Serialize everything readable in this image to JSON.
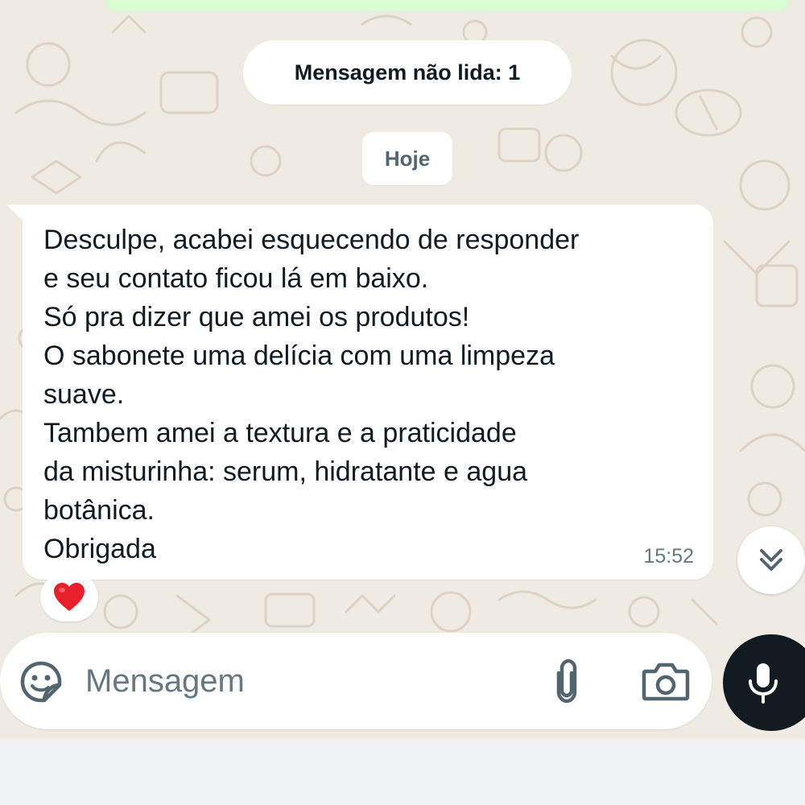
{
  "unread_banner": {
    "text": "Mensagem não lida: 1"
  },
  "date_chip": {
    "text": "Hoje"
  },
  "message": {
    "lines": [
      "Desculpe, acabei esquecendo de responder",
      "e seu contato ficou lá em baixo.",
      "Só pra dizer que amei os produtos!",
      "O sabonete uma delícia com uma limpeza",
      "suave.",
      "Tambem amei a textura e a praticidade",
      "da misturinha: serum, hidratante e agua",
      "botânica.",
      "Obrigada"
    ],
    "time": "15:52",
    "reaction": "heart-icon"
  },
  "composer": {
    "placeholder": "Mensagem",
    "value": "",
    "icons": [
      "sticker-icon",
      "paperclip-icon",
      "camera-icon",
      "mic-icon"
    ]
  },
  "scroll_button": {
    "icon": "chevron-double-down-icon"
  },
  "colors": {
    "chat_background": "#efeae2",
    "bubble": "#ffffff",
    "outgoing_bubble": "#d9fdd3",
    "mic_button": "#111b21",
    "heart": "#e8202a",
    "muted_text": "#667781"
  }
}
